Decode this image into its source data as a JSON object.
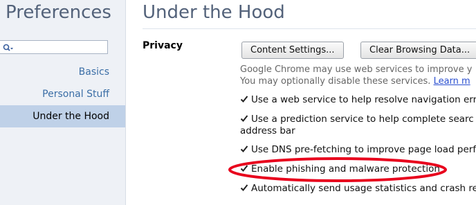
{
  "sidebar": {
    "title": "Preferences",
    "search": {
      "value": "",
      "placeholder": ""
    },
    "items": [
      {
        "label": "Basics"
      },
      {
        "label": "Personal Stuff"
      },
      {
        "label": "Under the Hood",
        "selected": true
      }
    ]
  },
  "main": {
    "title": "Under the Hood",
    "privacy": {
      "section_label": "Privacy",
      "content_settings_label": "Content Settings...",
      "clear_browsing_label": "Clear Browsing Data...",
      "desc_line1": "Google Chrome may use web services to improve y",
      "desc_line2": "You may optionally disable these services",
      "learn_more": "Learn m",
      "options": [
        {
          "label": "Use a web service to help resolve navigation erro",
          "checked": true
        },
        {
          "label": "Use a prediction service to help complete searc",
          "label2": "address bar",
          "checked": true
        },
        {
          "label": "Use DNS pre-fetching to improve page load perf",
          "checked": true
        },
        {
          "label": "Enable phishing and malware protection",
          "checked": true,
          "highlighted": true
        },
        {
          "label": "Automatically send usage statistics and crash re",
          "checked": true
        }
      ]
    }
  },
  "colors": {
    "sidebar_bg": "#eef1f6",
    "selected_bg": "#bfd1e8",
    "link": "#3b6ea6",
    "title": "#53627a",
    "highlight": "#e8001c"
  }
}
